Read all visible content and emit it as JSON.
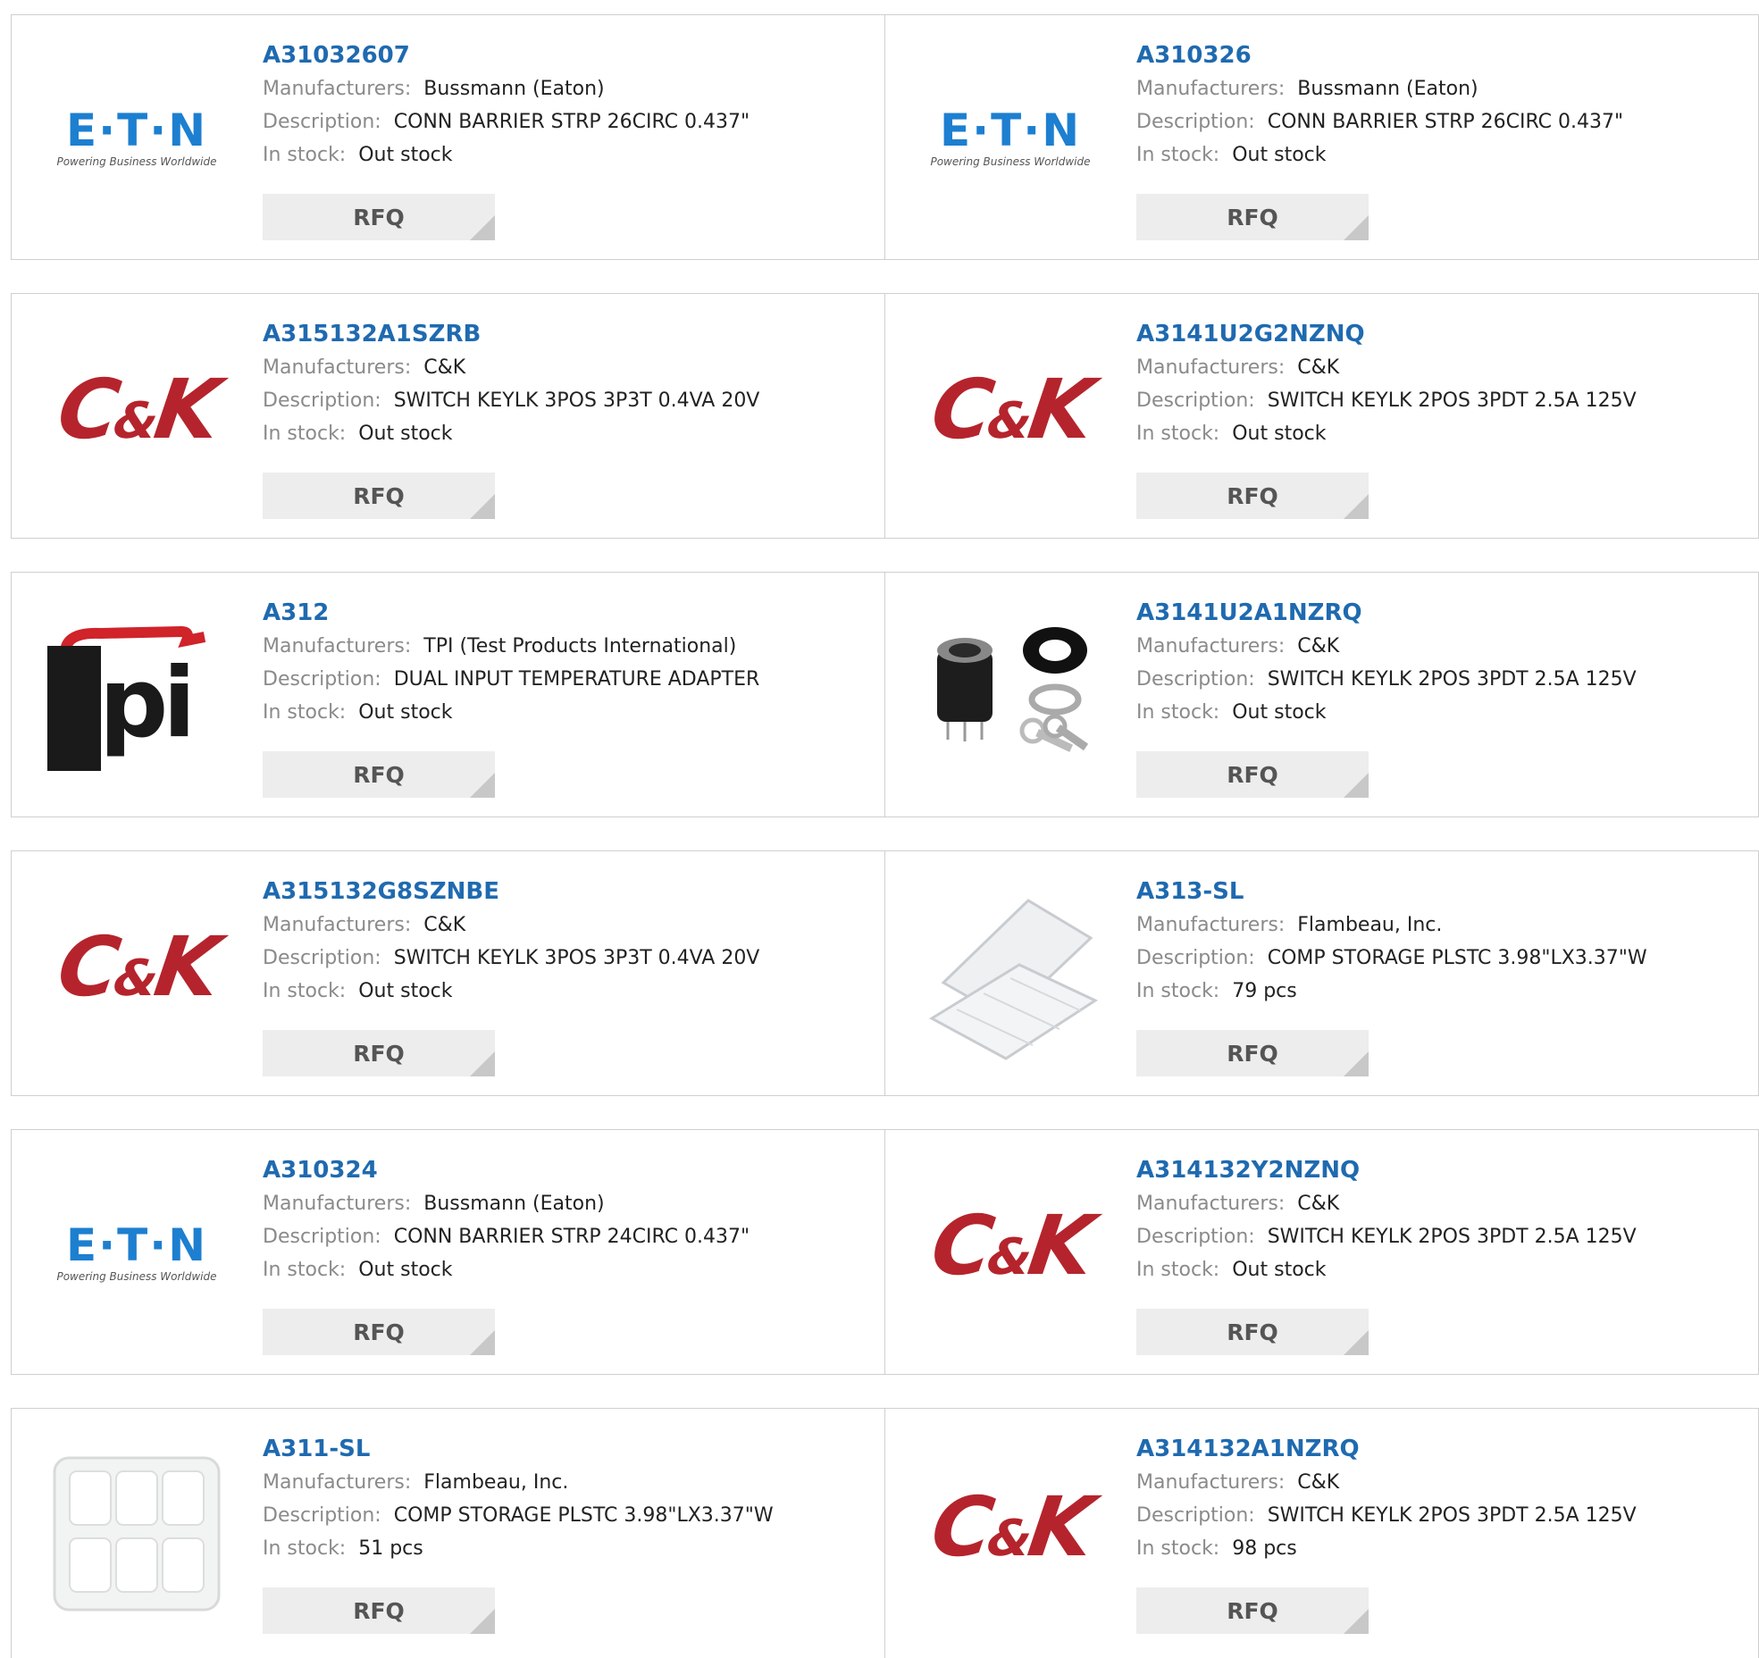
{
  "labels": {
    "manufacturers": "Manufacturers:",
    "description": "Description:",
    "in_stock": "In stock:",
    "rfq": "RFQ"
  },
  "logos": {
    "eaton_word": "E·T·N",
    "eaton_tag": "Powering Business Worldwide",
    "ck_c": "C",
    "ck_amp": "&",
    "ck_k": "K",
    "tpi_word": "pi"
  },
  "colors": {
    "link": "#1f6ab0",
    "label": "#8a8a8a",
    "button_bg": "#ededed",
    "border": "#cfcfcf"
  },
  "products": [
    {
      "part": "A31032607",
      "manufacturer": "Bussmann (Eaton)",
      "description": "CONN BARRIER STRP 26CIRC 0.437\"",
      "stock": "Out stock",
      "logo": "eaton-logo"
    },
    {
      "part": "A310326",
      "manufacturer": "Bussmann (Eaton)",
      "description": "CONN BARRIER STRP 26CIRC 0.437\"",
      "stock": "Out stock",
      "logo": "eaton-logo"
    },
    {
      "part": "A315132A1SZRB",
      "manufacturer": "C&K",
      "description": "SWITCH KEYLK 3POS 3P3T 0.4VA 20V",
      "stock": "Out stock",
      "logo": "ck-logo"
    },
    {
      "part": "A3141U2G2NZNQ",
      "manufacturer": "C&K",
      "description": "SWITCH KEYLK 2POS 3PDT 2.5A 125V",
      "stock": "Out stock",
      "logo": "ck-logo"
    },
    {
      "part": "A312",
      "manufacturer": "TPI (Test Products International)",
      "description": "DUAL INPUT TEMPERATURE ADAPTER",
      "stock": "Out stock",
      "logo": "tpi-logo"
    },
    {
      "part": "A3141U2A1NZRQ",
      "manufacturer": "C&K",
      "description": "SWITCH KEYLK 2POS 3PDT 2.5A 125V",
      "stock": "Out stock",
      "logo": "keylock-switch-photo"
    },
    {
      "part": "A315132G8SZNBE",
      "manufacturer": "C&K",
      "description": "SWITCH KEYLK 3POS 3P3T 0.4VA 20V",
      "stock": "Out stock",
      "logo": "ck-logo"
    },
    {
      "part": "A313-SL",
      "manufacturer": "Flambeau, Inc.",
      "description": "COMP STORAGE PLSTC 3.98\"LX3.37\"W",
      "stock": "79 pcs",
      "logo": "storage-box-open-photo"
    },
    {
      "part": "A310324",
      "manufacturer": "Bussmann (Eaton)",
      "description": "CONN BARRIER STRP 24CIRC 0.437\"",
      "stock": "Out stock",
      "logo": "eaton-logo"
    },
    {
      "part": "A314132Y2NZNQ",
      "manufacturer": "C&K",
      "description": "SWITCH KEYLK 2POS 3PDT 2.5A 125V",
      "stock": "Out stock",
      "logo": "ck-logo"
    },
    {
      "part": "A311-SL",
      "manufacturer": "Flambeau, Inc.",
      "description": "COMP STORAGE PLSTC 3.98\"LX3.37\"W",
      "stock": "51 pcs",
      "logo": "storage-box-closed-photo"
    },
    {
      "part": "A314132A1NZRQ",
      "manufacturer": "C&K",
      "description": "SWITCH KEYLK 2POS 3PDT 2.5A 125V",
      "stock": "98 pcs",
      "logo": "ck-logo"
    }
  ]
}
